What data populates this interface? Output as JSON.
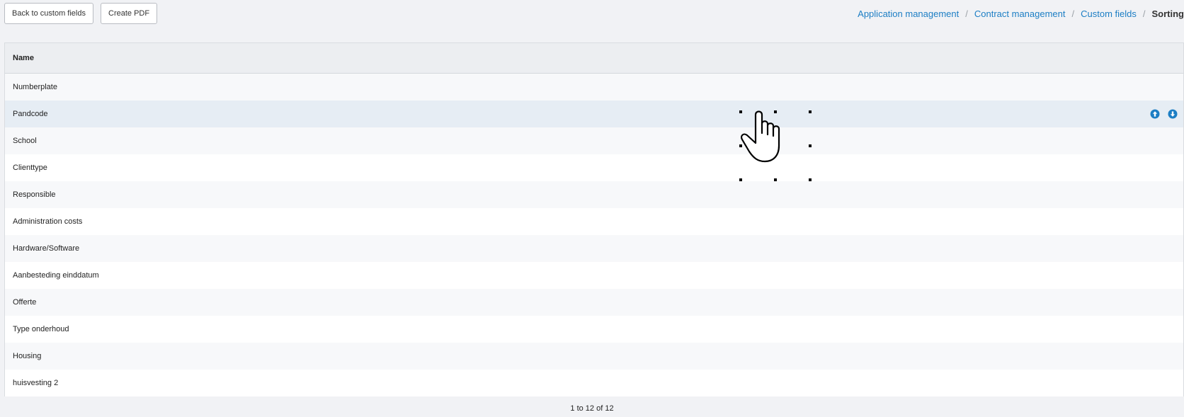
{
  "toolbar": {
    "back_label": "Back to custom fields",
    "pdf_label": "Create PDF"
  },
  "breadcrumb": {
    "items": [
      "Application management",
      "Contract management",
      "Custom fields"
    ],
    "separator": "/",
    "current": "Sorting"
  },
  "table": {
    "header": "Name",
    "rows": [
      "Numberplate",
      "Pandcode",
      "School",
      "Clienttype",
      "Responsible",
      "Administration costs",
      "Hardware/Software",
      "Aanbesteding einddatum",
      "Offerte",
      "Type onderhoud",
      "Housing",
      "huisvesting 2"
    ],
    "hovered_row": 1,
    "row_actions": [
      "arrow-up-circle-icon",
      "arrow-down-circle-icon"
    ]
  },
  "pagination": {
    "summary": "1 to 12 of 12"
  },
  "colors": {
    "link": "#1c7ec4",
    "hover_row": "#e6edf4",
    "striped_row": "#f7f8fa"
  }
}
